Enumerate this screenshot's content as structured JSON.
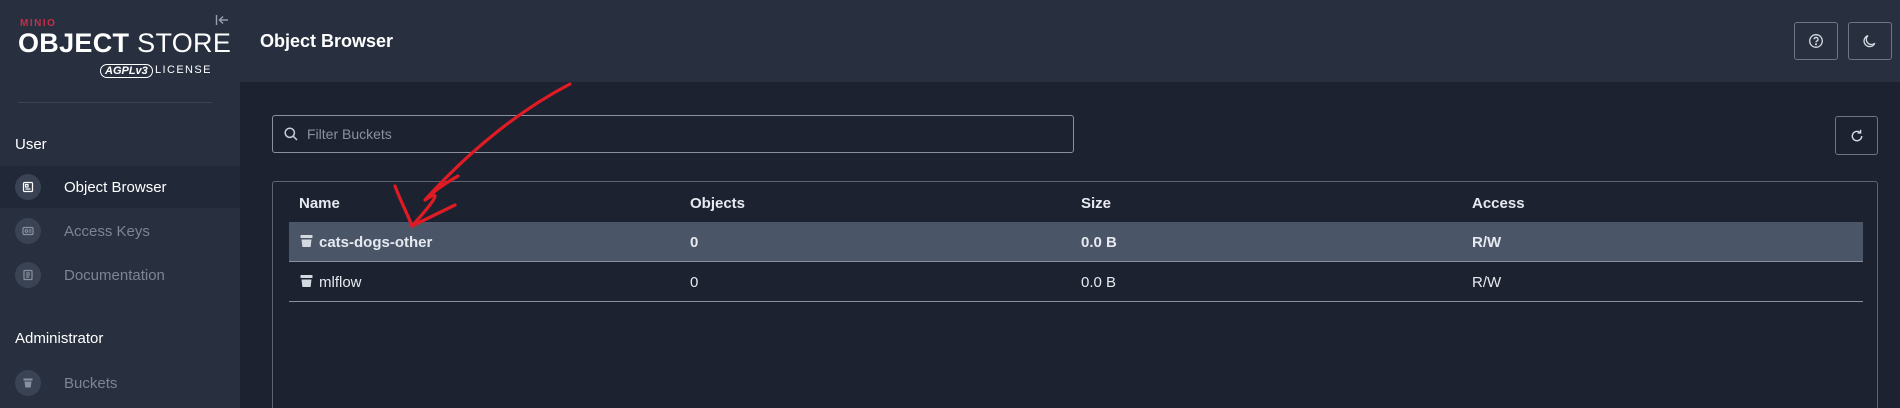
{
  "branding": {
    "brand": "MINIO",
    "product_bold": "OBJECT",
    "product_rest": " STORE",
    "license_badge": "AGPLv3",
    "license_label": "LICENSE"
  },
  "sidebar": {
    "sections": [
      {
        "title": "User",
        "items": [
          {
            "label": "Object Browser",
            "icon": "object-browser-icon",
            "active": true
          },
          {
            "label": "Access Keys",
            "icon": "access-keys-icon",
            "active": false
          },
          {
            "label": "Documentation",
            "icon": "documentation-icon",
            "active": false
          }
        ]
      },
      {
        "title": "Administrator",
        "items": [
          {
            "label": "Buckets",
            "icon": "bucket-icon",
            "active": false
          }
        ]
      }
    ]
  },
  "header": {
    "title": "Object Browser"
  },
  "filter": {
    "placeholder": "Filter Buckets",
    "value": ""
  },
  "table": {
    "columns": [
      "Name",
      "Objects",
      "Size",
      "Access"
    ],
    "rows": [
      {
        "name": "cats-dogs-other",
        "objects": "0",
        "size": "0.0 B",
        "access": "R/W",
        "selected": true
      },
      {
        "name": "mlflow",
        "objects": "0",
        "size": "0.0 B",
        "access": "R/W",
        "selected": false
      }
    ]
  },
  "colors": {
    "brand_red": "#c72c48",
    "annotation_red": "#e01b24",
    "sidebar_bg": "#283040",
    "content_bg": "#1c2230",
    "selected_row_bg": "#4a5568"
  }
}
